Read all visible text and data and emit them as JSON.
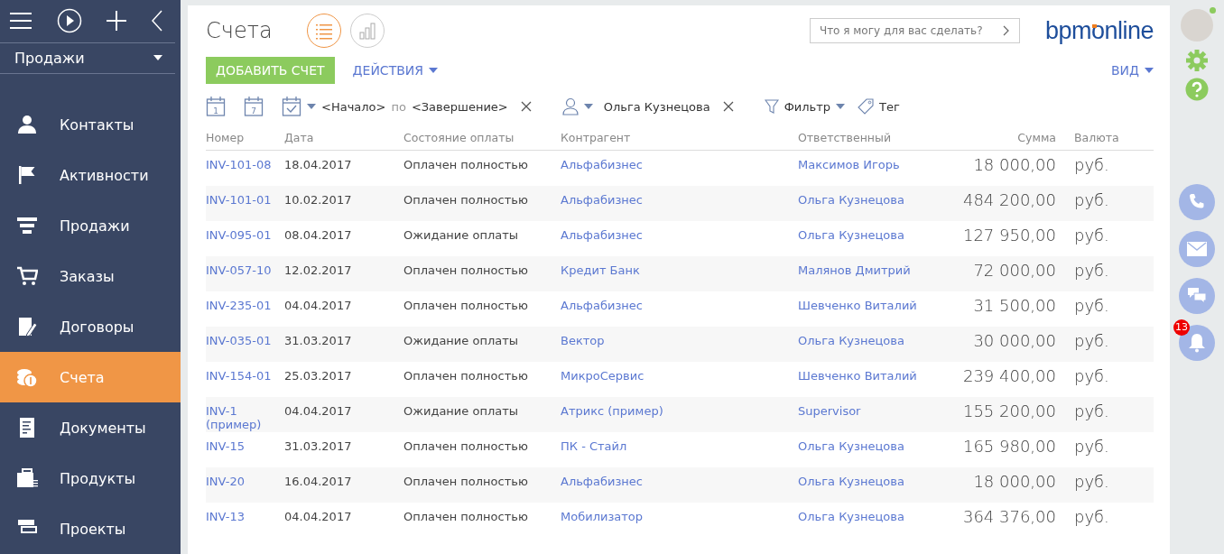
{
  "sidebar": {
    "section": "Продажи",
    "items": [
      {
        "label": "Контакты",
        "selected": false
      },
      {
        "label": "Активности",
        "selected": false
      },
      {
        "label": "Продажи",
        "selected": false
      },
      {
        "label": "Заказы",
        "selected": false
      },
      {
        "label": "Договоры",
        "selected": false
      },
      {
        "label": "Счета",
        "selected": true
      },
      {
        "label": "Документы",
        "selected": false
      },
      {
        "label": "Продукты",
        "selected": false
      },
      {
        "label": "Проекты",
        "selected": false
      }
    ]
  },
  "header": {
    "title": "Счета",
    "views": [
      {
        "kind": "list",
        "selected": true
      },
      {
        "kind": "chart",
        "selected": false
      }
    ],
    "command_placeholder": "Что я могу для вас сделать?",
    "logo": "bpmonline"
  },
  "toolbar": {
    "add_button": "ДОБАВИТЬ СЧЕТ",
    "actions": "ДЕЙСТВИЯ",
    "view": "ВИД"
  },
  "filters": {
    "day_icon_label": "1",
    "week_icon_label": "7",
    "start": "<Начало>",
    "by": "по",
    "end": "<Завершение>",
    "owner": "Ольга Кузнецова",
    "filter": "Фильтр",
    "tag": "Тег"
  },
  "table": {
    "columns": [
      "Номер",
      "Дата",
      "Состояние оплаты",
      "Контрагент",
      "Ответственный",
      "Сумма",
      "Валюта"
    ],
    "rows": [
      [
        "INV-101-08",
        "18.04.2017",
        "Оплачен полностью",
        "Альфабизнес",
        "Максимов Игорь",
        "18 000,00",
        "руб."
      ],
      [
        "INV-101-01",
        "10.02.2017",
        "Оплачен полностью",
        "Альфабизнес",
        "Ольга Кузнецова",
        "484 200,00",
        "руб."
      ],
      [
        "INV-095-01",
        "08.04.2017",
        "Ожидание оплаты",
        "Альфабизнес",
        "Ольга Кузнецова",
        "127 950,00",
        "руб."
      ],
      [
        "INV-057-10",
        "12.02.2017",
        "Оплачен полностью",
        "Кредит Банк",
        "Малянов Дмитрий",
        "72 000,00",
        "руб."
      ],
      [
        "INV-235-01",
        "04.04.2017",
        "Оплачен полностью",
        "Альфабизнес",
        "Шевченко Виталий",
        "31 500,00",
        "руб."
      ],
      [
        "INV-035-01",
        "31.03.2017",
        "Ожидание оплаты",
        "Вектор",
        "Ольга Кузнецова",
        "30 000,00",
        "руб."
      ],
      [
        "INV-154-01",
        "25.03.2017",
        "Оплачен полностью",
        "МикроСервис",
        "Шевченко Виталий",
        "239 400,00",
        "руб."
      ],
      [
        "INV-1 (пример)",
        "04.04.2017",
        "Ожидание оплаты",
        "Атрикс (пример)",
        "Supervisor",
        "155 200,00",
        "руб."
      ],
      [
        "INV-15",
        "31.03.2017",
        "Оплачен полностью",
        "ПК - Стайл",
        "Ольга Кузнецова",
        "165 980,00",
        "руб."
      ],
      [
        "INV-20",
        "16.04.2017",
        "Оплачен полностью",
        "Альфабизнес",
        "Ольга Кузнецова",
        "18 000,00",
        "руб."
      ],
      [
        "INV-13",
        "04.04.2017",
        "Оплачен полностью",
        "Мобилизатор",
        "Ольга Кузнецова",
        "364 376,00",
        "руб."
      ]
    ]
  },
  "right_bar": {
    "user_online": true,
    "notifications": "13"
  }
}
